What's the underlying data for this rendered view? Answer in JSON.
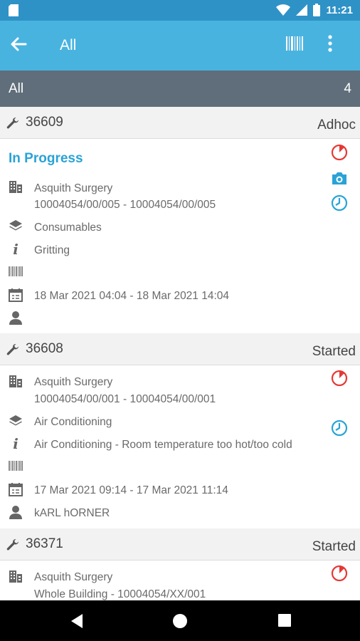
{
  "status_bar": {
    "time": "11:21"
  },
  "app_bar": {
    "title": "All"
  },
  "section": {
    "label": "All",
    "count": "4"
  },
  "jobs": [
    {
      "number": "36609",
      "state": "Adhoc",
      "status": "In Progress",
      "site": "Asquith Surgery",
      "location": "10004054/00/005 - 10004054/00/005",
      "category": "Consumables",
      "description": "Gritting",
      "barcode": "",
      "dates": "18 Mar 2021 04:04 - 18 Mar 2021 14:04",
      "assignee": ""
    },
    {
      "number": "36608",
      "state": "Started",
      "site": "Asquith Surgery",
      "location": "10004054/00/001 - 10004054/00/001",
      "category": "Air Conditioning",
      "description": "Air Conditioning - Room temperature too hot/too cold",
      "barcode": "",
      "dates": "17 Mar 2021 09:14 - 17 Mar 2021 11:14",
      "assignee": "kARL hORNER"
    },
    {
      "number": "36371",
      "state": "Started",
      "site": "Asquith Surgery",
      "location": "Whole Building - 10004054/XX/001"
    }
  ],
  "colors": {
    "status_bar": "#2e92c6",
    "app_bar": "#49b3e0",
    "section": "#5f6e7a",
    "accent": "#29a3d6",
    "alert": "#e53935"
  },
  "icons": {
    "status_bar": [
      "sd-card-icon",
      "wifi-icon",
      "signal-icon",
      "battery-icon"
    ],
    "app_bar": [
      "back-arrow-icon",
      "barcode-scanner-icon",
      "more-vert-icon"
    ],
    "rows": [
      "building-icon",
      "layers-icon",
      "info-icon",
      "barcode-icon",
      "calendar-icon",
      "person-icon"
    ],
    "side": [
      "timer-alert-icon",
      "camera-icon",
      "clock-icon"
    ],
    "nav": [
      "nav-back-icon",
      "nav-home-icon",
      "nav-recents-icon"
    ]
  }
}
